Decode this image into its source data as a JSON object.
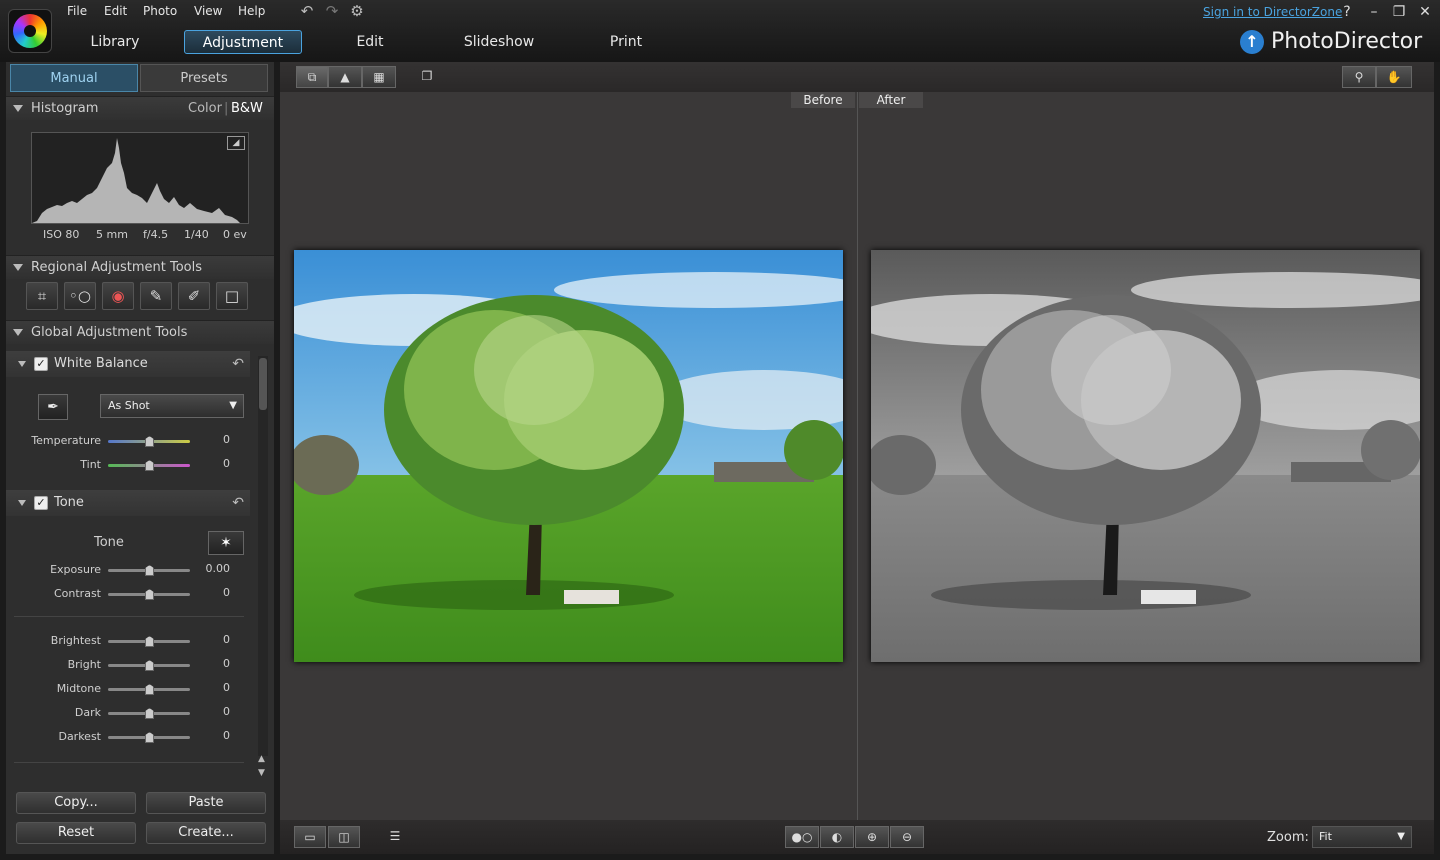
{
  "menu": {
    "file": "File",
    "edit": "Edit",
    "photo": "Photo",
    "view": "View",
    "help": "Help"
  },
  "nav": {
    "library": "Library",
    "adjustment": "Adjustment",
    "edit": "Edit",
    "slideshow": "Slideshow",
    "print": "Print"
  },
  "top_right": {
    "signin": "Sign in to DirectorZone",
    "help": "?",
    "brand": "PhotoDirector"
  },
  "panel_tabs": {
    "manual": "Manual",
    "presets": "Presets"
  },
  "histogram": {
    "title": "Histogram",
    "color": "Color",
    "sep": "|",
    "bw": "B&W",
    "exif": [
      "ISO 80",
      "5 mm",
      "f/4.5",
      "1/40",
      "0 ev"
    ]
  },
  "regional": {
    "title": "Regional Adjustment Tools",
    "tools": [
      "crop-tool",
      "spot-removal-tool",
      "red-eye-tool",
      "adjustment-brush-tool",
      "gradient-mask-tool",
      "radial-filter-tool"
    ]
  },
  "global": {
    "title": "Global Adjustment Tools"
  },
  "white_balance": {
    "title": "White Balance",
    "preset": "As Shot",
    "sliders": [
      {
        "label": "Temperature",
        "value": "0",
        "pos": 0.5
      },
      {
        "label": "Tint",
        "value": "0",
        "pos": 0.5
      }
    ]
  },
  "tone": {
    "title": "Tone",
    "sub_label": "Tone",
    "sliders": [
      {
        "label": "Exposure",
        "value": "0.00",
        "pos": 0.5
      },
      {
        "label": "Contrast",
        "value": "0",
        "pos": 0.5
      }
    ],
    "range_sliders": [
      {
        "label": "Brightest",
        "value": "0",
        "pos": 0.5
      },
      {
        "label": "Bright",
        "value": "0",
        "pos": 0.5
      },
      {
        "label": "Midtone",
        "value": "0",
        "pos": 0.5
      },
      {
        "label": "Dark",
        "value": "0",
        "pos": 0.5
      },
      {
        "label": "Darkest",
        "value": "0",
        "pos": 0.5
      }
    ]
  },
  "buttons": {
    "copy": "Copy...",
    "paste": "Paste",
    "reset": "Reset",
    "create": "Create..."
  },
  "viewer": {
    "before": "Before",
    "after": "After",
    "zoom_label": "Zoom:",
    "zoom_value": "Fit"
  }
}
